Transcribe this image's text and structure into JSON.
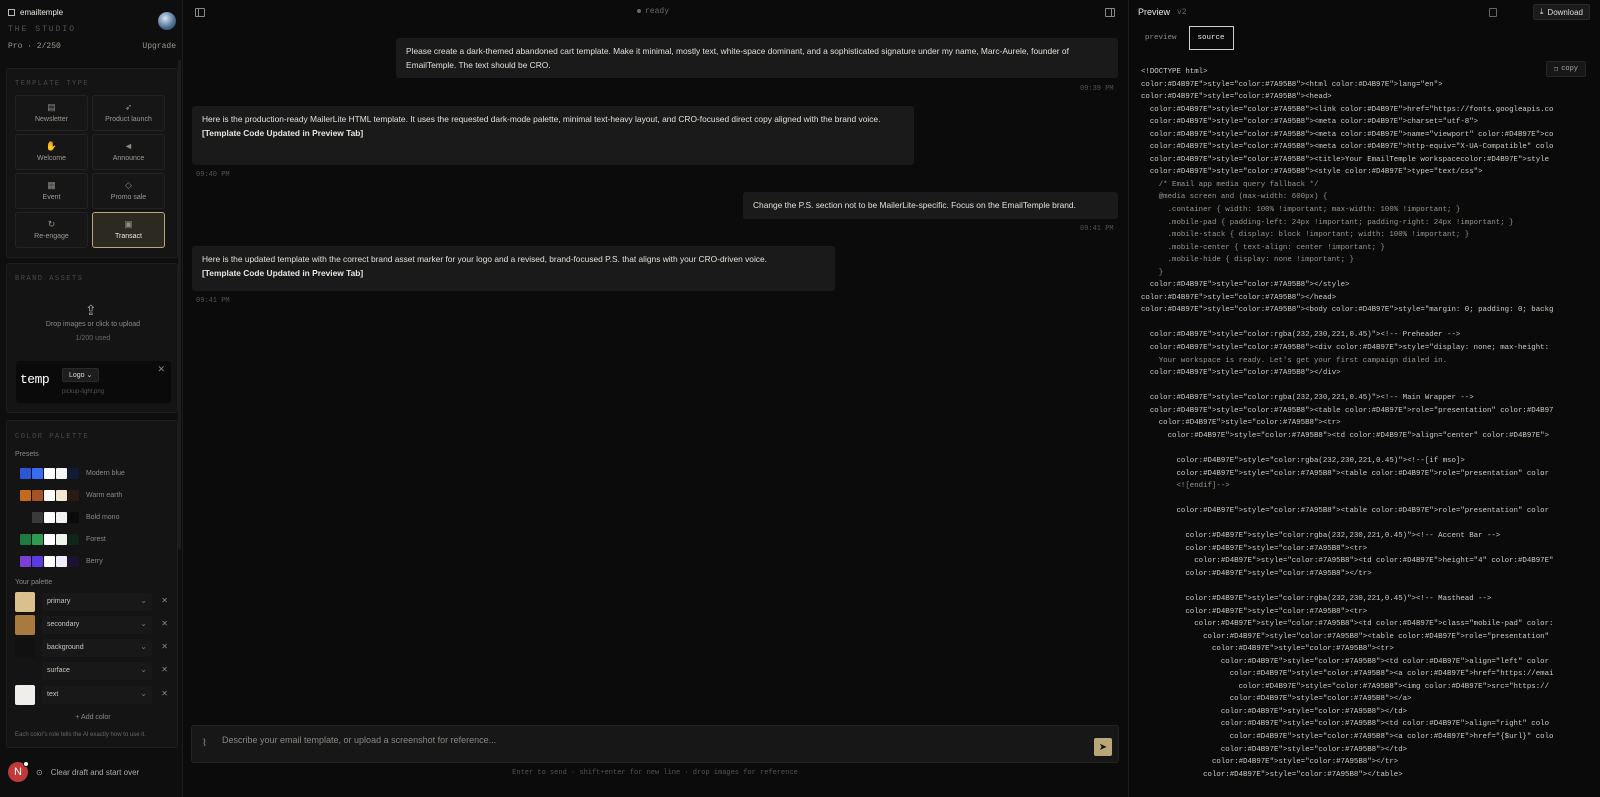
{
  "sidebar": {
    "brand": "emailtemple",
    "studio": "THE STUDIO",
    "plan": "Pro · 2/250",
    "upgrade": "Upgrade",
    "template_type": {
      "title": "TEMPLATE TYPE",
      "items": [
        {
          "label": "Newsletter",
          "icon": "newspaper-icon"
        },
        {
          "label": "Product launch",
          "icon": "rocket-icon"
        },
        {
          "label": "Welcome",
          "icon": "hand-wave-icon"
        },
        {
          "label": "Announce",
          "icon": "megaphone-icon"
        },
        {
          "label": "Event",
          "icon": "calendar-icon"
        },
        {
          "label": "Promo sale",
          "icon": "tag-icon"
        },
        {
          "label": "Re-engage",
          "icon": "refresh-icon"
        },
        {
          "label": "Transact",
          "icon": "receipt-icon",
          "selected": true
        }
      ]
    },
    "brand_assets": {
      "title": "BRAND ASSETS",
      "upload_text": "Drop images or click to upload",
      "upload_count": "1/200 used",
      "asset": {
        "preview": "temp",
        "type": "Logo",
        "file": "pickup-light.png"
      }
    },
    "color_palette": {
      "title": "COLOR PALETTE",
      "presets_label": "Presets",
      "presets": [
        {
          "name": "Modern blue",
          "colors": [
            "#2f55d4",
            "#3b6cf0",
            "#ffffff",
            "#f4f4f4",
            "#101a33"
          ]
        },
        {
          "name": "Warm earth",
          "colors": [
            "#c56a1c",
            "#a5522a",
            "#ffffff",
            "#f3e6cf",
            "#2a1a10"
          ]
        },
        {
          "name": "Bold mono",
          "colors": [
            "#141414",
            "#3a3a3a",
            "#ffffff",
            "#f2f2f2",
            "#0a0a0a"
          ]
        },
        {
          "name": "Forest",
          "colors": [
            "#1f7a3e",
            "#2e9a52",
            "#ffffff",
            "#eef5ec",
            "#102418"
          ]
        },
        {
          "name": "Berry",
          "colors": [
            "#7a3fd6",
            "#5b3be0",
            "#ffffff",
            "#f1ecfb",
            "#1c1230"
          ]
        }
      ],
      "your_palette_label": "Your palette",
      "palette": [
        {
          "name": "primary",
          "color": "#d9c08c"
        },
        {
          "name": "secondary",
          "color": "#a87a40"
        },
        {
          "name": "background",
          "color": "#111111"
        },
        {
          "name": "surface",
          "color": "#141414"
        },
        {
          "name": "text",
          "color": "#efeeea"
        }
      ],
      "add_color": "+ Add color",
      "hint": "Each color's role tells the AI exactly how to use it."
    },
    "clear_draft": "Clear draft and start over",
    "user_initial": "N"
  },
  "chat": {
    "status": "ready",
    "messages": [
      {
        "role": "user",
        "text": "Please create a dark-themed abandoned cart template. Make it minimal, mostly text, white-space dominant, and a sophisticated signature under my name, Marc-Aurele, founder of EmailTemple. The text should be CRO.",
        "time": "09:39 PM"
      },
      {
        "role": "assistant",
        "text": "Here is the production-ready MailerLite HTML template. It uses the requested dark-mode palette, minimal text-heavy layout, and CRO-focused direct copy aligned with the brand voice.",
        "note": "[Template Code Updated in Preview Tab]",
        "time": "09:40 PM"
      },
      {
        "role": "user",
        "text": "Change the P.S. section not to be MailerLite-specific. Focus on the EmailTemple brand.",
        "time": "09:41 PM"
      },
      {
        "role": "assistant",
        "text": "Here is the updated template with the correct brand asset marker for your logo and a revised, brand-focused P.S. that aligns with your CRO-driven voice.",
        "note": "[Template Code Updated in Preview Tab]",
        "time": "09:41 PM"
      }
    ],
    "composer_placeholder": "Describe your email template, or upload a screenshot for reference...",
    "hint": "Enter to send · shift+enter for new line · drop images for reference"
  },
  "preview": {
    "title": "Preview",
    "count": "v2",
    "download": "Download",
    "tabs": [
      "preview",
      "source"
    ],
    "active_tab": "source",
    "copy": "copy",
    "source_lines": [
      "<!DOCTYPE html>",
      "color:#D4B97E\">style=\"color:#7A95B8\"><html color:#D4B97E\">lang=\"en\">",
      "color:#D4B97E\">style=\"color:#7A95B8\"><head>",
      "  color:#D4B97E\">style=\"color:#7A95B8\"><link color:#D4B97E\">href=\"https://fonts.googleapis.co",
      "  color:#D4B97E\">style=\"color:#7A95B8\"><meta color:#D4B97E\">charset=\"utf-8\">",
      "  color:#D4B97E\">style=\"color:#7A95B8\"><meta color:#D4B97E\">name=\"viewport\" color:#D4B97E\">co",
      "  color:#D4B97E\">style=\"color:#7A95B8\"><meta color:#D4B97E\">http-equiv=\"X-UA-Compatible\" colo",
      "  color:#D4B97E\">style=\"color:#7A95B8\"><title>Your EmailTemple workspacecolor:#D4B97E\">style",
      "  color:#D4B97E\">style=\"color:#7A95B8\"><style color:#D4B97E\">type=\"text/css\">",
      "    /* Email app media query fallback */",
      "    @media screen and (max-width: 600px) {",
      "      .container { width: 100% !important; max-width: 100% !important; }",
      "      .mobile-pad { padding-left: 24px !important; padding-right: 24px !important; }",
      "      .mobile-stack { display: block !important; width: 100% !important; }",
      "      .mobile-center { text-align: center !important; }",
      "      .mobile-hide { display: none !important; }",
      "    }",
      "  color:#D4B97E\">style=\"color:#7A95B8\"></style>",
      "color:#D4B97E\">style=\"color:#7A95B8\"></head>",
      "color:#D4B97E\">style=\"color:#7A95B8\"><body color:#D4B97E\">style=\"margin: 0; padding: 0; backg",
      "",
      "  color:#D4B97E\">style=\"color:rgba(232,230,221,0.45)\"><!-- Preheader -->",
      "  color:#D4B97E\">style=\"color:#7A95B8\"><div color:#D4B97E\">style=\"display: none; max-height:",
      "    Your workspace is ready. Let's get your first campaign dialed in.",
      "  color:#D4B97E\">style=\"color:#7A95B8\"></div>",
      "",
      "  color:#D4B97E\">style=\"color:rgba(232,230,221,0.45)\"><!-- Main Wrapper -->",
      "  color:#D4B97E\">style=\"color:#7A95B8\"><table color:#D4B97E\">role=\"presentation\" color:#D4B97",
      "    color:#D4B97E\">style=\"color:#7A95B8\"><tr>",
      "      color:#D4B97E\">style=\"color:#7A95B8\"><td color:#D4B97E\">align=\"center\" color:#D4B97E\">",
      "",
      "        color:#D4B97E\">style=\"color:rgba(232,230,221,0.45)\"><!--[if mso]>",
      "        color:#D4B97E\">style=\"color:#7A95B8\"><table color:#D4B97E\">role=\"presentation\" color",
      "        <![endif]-->",
      "",
      "        color:#D4B97E\">style=\"color:#7A95B8\"><table color:#D4B97E\">role=\"presentation\" color",
      "",
      "          color:#D4B97E\">style=\"color:rgba(232,230,221,0.45)\"><!-- Accent Bar -->",
      "          color:#D4B97E\">style=\"color:#7A95B8\"><tr>",
      "            color:#D4B97E\">style=\"color:#7A95B8\"><td color:#D4B97E\">height=\"4\" color:#D4B97E\"",
      "          color:#D4B97E\">style=\"color:#7A95B8\"></tr>",
      "",
      "          color:#D4B97E\">style=\"color:rgba(232,230,221,0.45)\"><!-- Masthead -->",
      "          color:#D4B97E\">style=\"color:#7A95B8\"><tr>",
      "            color:#D4B97E\">style=\"color:#7A95B8\"><td color:#D4B97E\">class=\"mobile-pad\" color:",
      "              color:#D4B97E\">style=\"color:#7A95B8\"><table color:#D4B97E\">role=\"presentation\"",
      "                color:#D4B97E\">style=\"color:#7A95B8\"><tr>",
      "                  color:#D4B97E\">style=\"color:#7A95B8\"><td color:#D4B97E\">align=\"left\" color",
      "                    color:#D4B97E\">style=\"color:#7A95B8\"><a color:#D4B97E\">href=\"https://emai",
      "                      color:#D4B97E\">style=\"color:#7A95B8\"><img color:#D4B97E\">src=\"https://",
      "                    color:#D4B97E\">style=\"color:#7A95B8\"></a>",
      "                  color:#D4B97E\">style=\"color:#7A95B8\"></td>",
      "                  color:#D4B97E\">style=\"color:#7A95B8\"><td color:#D4B97E\">align=\"right\" colo",
      "                    color:#D4B97E\">style=\"color:#7A95B8\"><a color:#D4B97E\">href=\"{$url}\" colo",
      "                  color:#D4B97E\">style=\"color:#7A95B8\"></td>",
      "                color:#D4B97E\">style=\"color:#7A95B8\"></tr>",
      "              color:#D4B97E\">style=\"color:#7A95B8\"></table>"
    ]
  }
}
